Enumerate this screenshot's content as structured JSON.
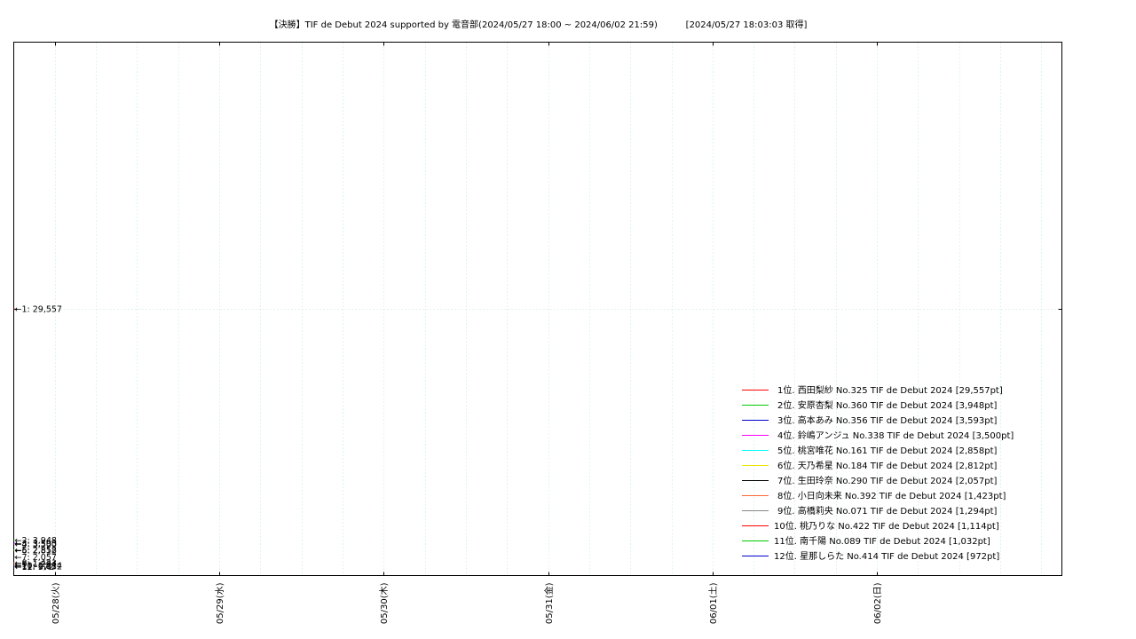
{
  "chart_data": {
    "type": "line",
    "title": "【決勝】TIF de Debut 2024 supported by 電音部(2024/05/27 18:00 ~ 2024/06/02 21:59)",
    "fetched": "[2024/05/27 18:03:03 取得]",
    "x_ticks": [
      "05/28(火)",
      "05/29(水)",
      "05/30(木)",
      "05/31(金)",
      "06/01(土)",
      "06/02(日)"
    ],
    "xlim": [
      "2024/05/27 18:00",
      "2024/06/03 03:00"
    ],
    "x_tick_dates": [
      "2024/05/28 00:00",
      "2024/05/29 00:00",
      "2024/05/30 00:00",
      "2024/05/31 00:00",
      "2024/06/01 00:00",
      "2024/06/02 00:00"
    ],
    "ylim": [
      0,
      59114
    ],
    "grid": true,
    "legend_position": "bottom-right",
    "series": [
      {
        "name": "1位. 西田梨紗 No.325 TIF de Debut 2024 [29,557pt]",
        "color": "#ff0000",
        "last_value": 29557,
        "end_label": "1: 29,557"
      },
      {
        "name": "2位. 安原杏梨 No.360 TIF de Debut 2024 [3,948pt]",
        "color": "#00cc00",
        "last_value": 3948,
        "end_label": "2: 3,948"
      },
      {
        "name": "3位. 高本あみ No.356 TIF de Debut 2024 [3,593pt]",
        "color": "#0000cc",
        "last_value": 3593,
        "end_label": "3: 3,593"
      },
      {
        "name": "4位. 鈴嶋アンジュ No.338 TIF de Debut 2024 [3,500pt]",
        "color": "#ff00ff",
        "last_value": 3500,
        "end_label": "4: 3,500"
      },
      {
        "name": "5位. 桃宮唯花 No.161 TIF de Debut 2024 [2,858pt]",
        "color": "#00ffff",
        "last_value": 2858,
        "end_label": "5: 2,858"
      },
      {
        "name": "6位. 天乃希星 No.184 TIF de Debut 2024 [2,812pt]",
        "color": "#e8e800",
        "last_value": 2812,
        "end_label": "6: 2,812"
      },
      {
        "name": "7位. 生田玲奈 No.290 TIF de Debut 2024 [2,057pt]",
        "color": "#000000",
        "last_value": 2057,
        "end_label": "7: 2,057"
      },
      {
        "name": "8位. 小日向未来 No.392 TIF de Debut 2024 [1,423pt]",
        "color": "#ff6633",
        "last_value": 1423,
        "end_label": "8: 1,423"
      },
      {
        "name": "9位. 高橋莉央 No.071 TIF de Debut 2024 [1,294pt]",
        "color": "#888888",
        "last_value": 1294,
        "end_label": "9: 1,294"
      },
      {
        "name": "10位. 桃乃りな No.422 TIF de Debut 2024 [1,114pt]",
        "color": "#ff0000",
        "last_value": 1114,
        "end_label": "10: 1,114"
      },
      {
        "name": "11位. 南千陽 No.089 TIF de Debut 2024 [1,032pt]",
        "color": "#00cc00",
        "last_value": 1032,
        "end_label": "11: 1,032"
      },
      {
        "name": "12位. 星那しらた No.414 TIF de Debut 2024 [972pt]",
        "color": "#0000cc",
        "last_value": 972,
        "end_label": "12: 972"
      }
    ]
  }
}
